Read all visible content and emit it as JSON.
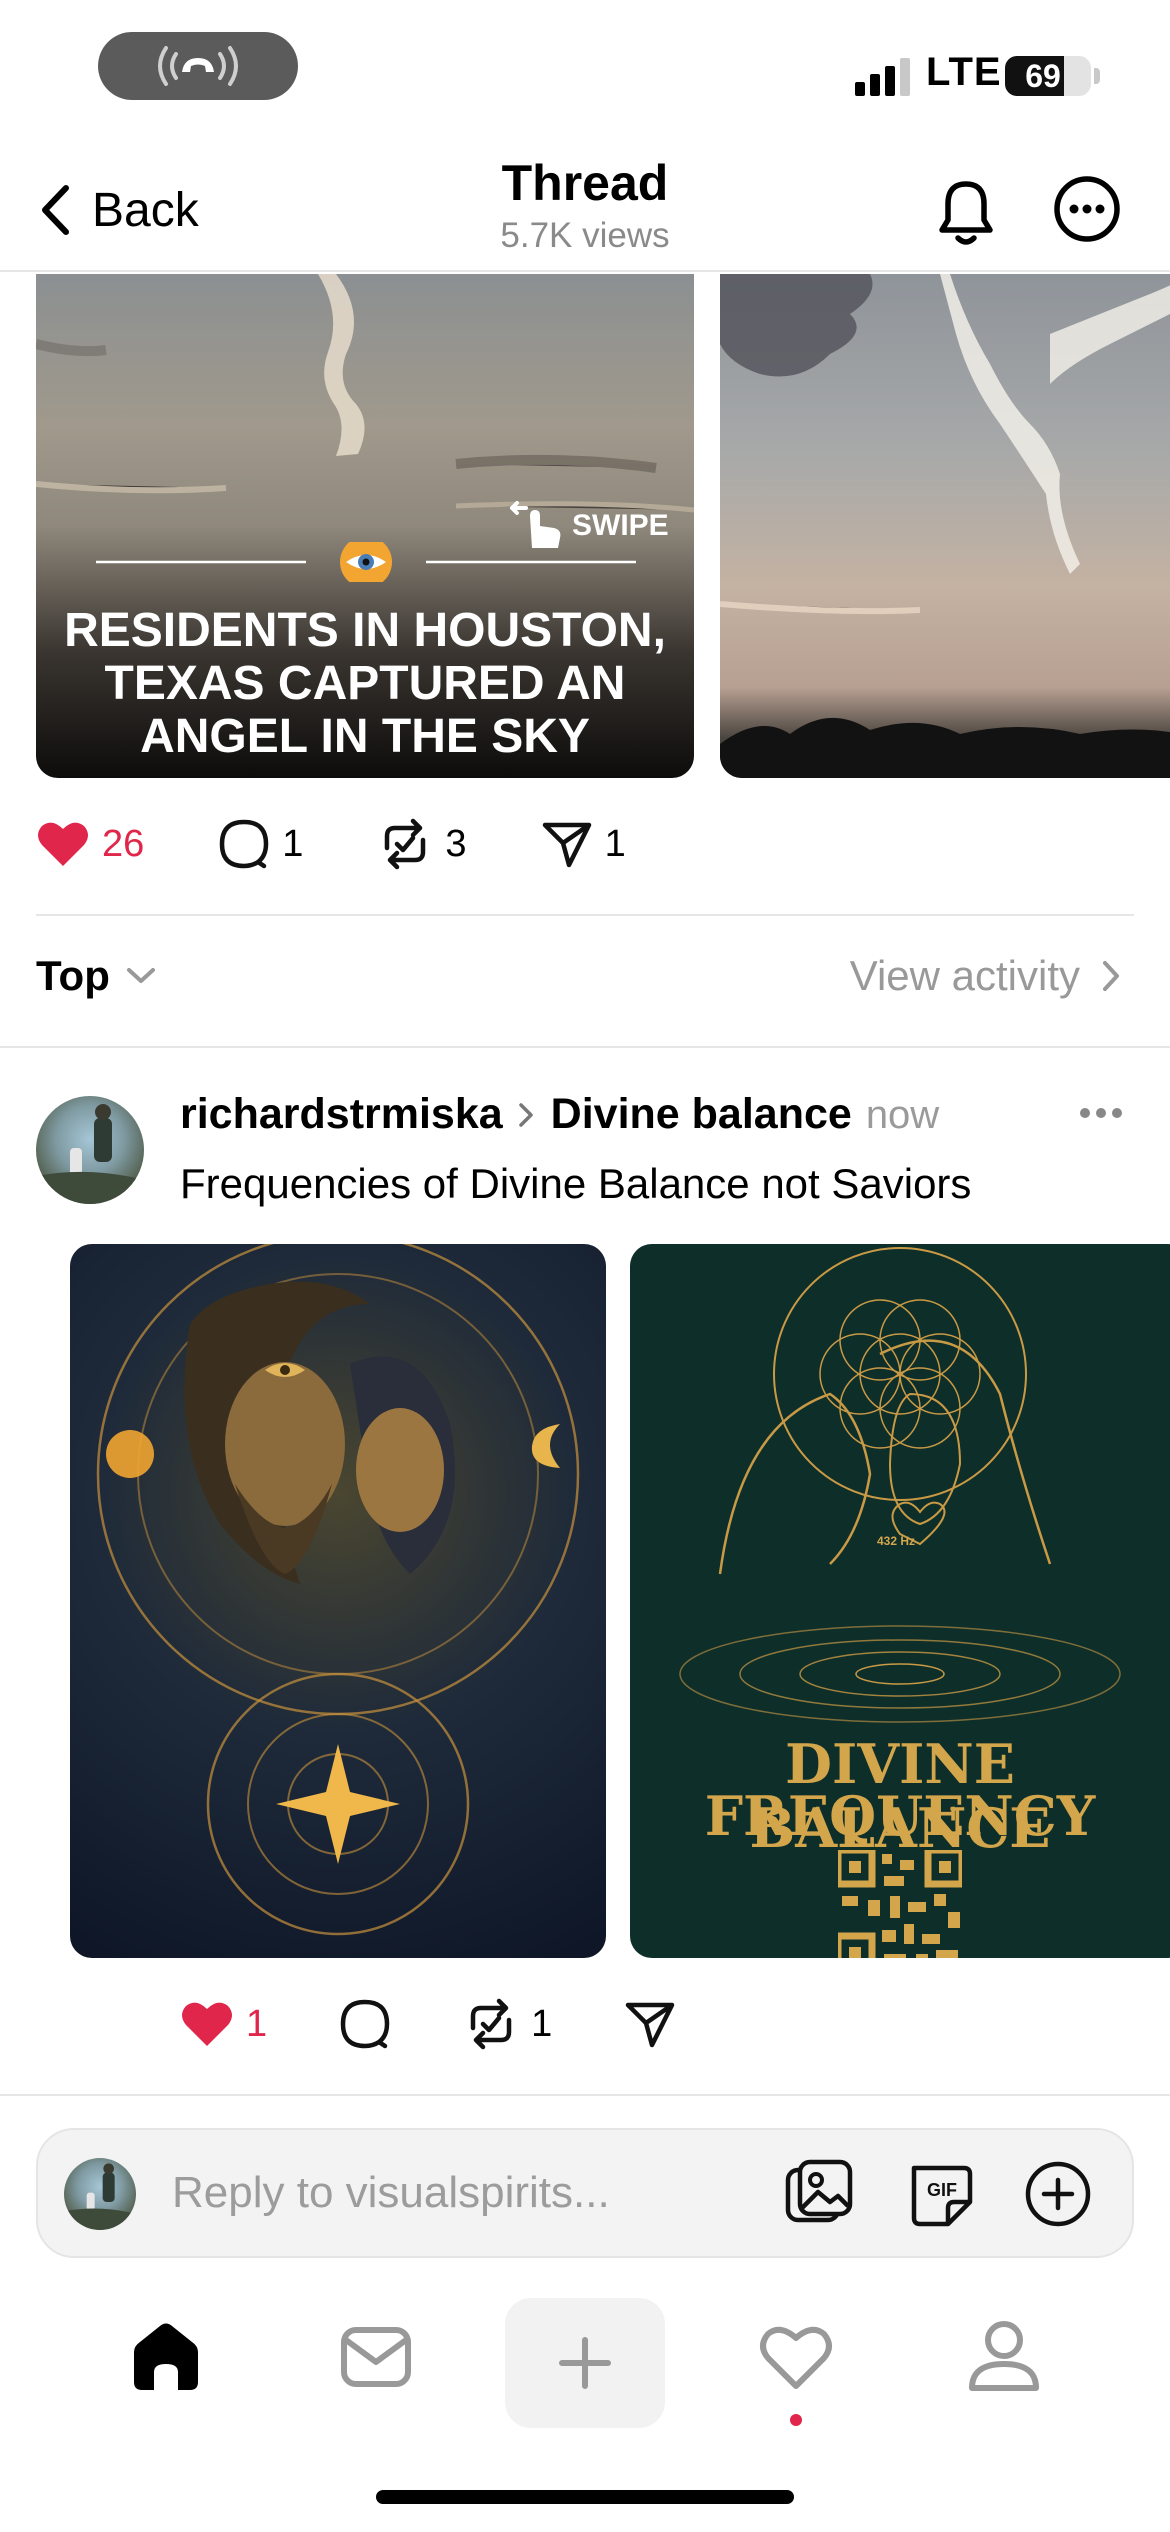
{
  "status_bar": {
    "network": "LTE",
    "battery": "69",
    "battery_level": 0.69,
    "signal_bars": 3
  },
  "header": {
    "back_label": "Back",
    "title": "Thread",
    "subtitle": "5.7K views"
  },
  "main_post": {
    "media_1": {
      "swipe_label": "SWIPE",
      "headline": "RESIDENTS IN HOUSTON, TEXAS CAPTURED AN ANGEL IN THE SKY"
    },
    "actions": {
      "likes": "26",
      "comments": "1",
      "reposts": "3",
      "shares": "1"
    }
  },
  "sort_bar": {
    "sort_label": "Top",
    "activity_label": "View activity"
  },
  "reply": {
    "username": "richardstrmiska",
    "topic": "Divine balance",
    "time": "now",
    "text": "Frequencies of Divine Balance not Saviors",
    "image_b": {
      "line1": "DIVINE BALANCE",
      "line2": "FREQUENCY",
      "hz_label": "432 Hz"
    },
    "actions": {
      "likes": "1",
      "reposts": "1"
    }
  },
  "composer": {
    "placeholder": "Reply to visualspirits...",
    "gif_label": "GIF"
  },
  "colors": {
    "like_red": "#e0264a",
    "muted_gray": "#999999",
    "gold": "#d4a64c"
  },
  "icons": [
    "phone-call-icon",
    "signal-icon",
    "back-chevron-icon",
    "bell-icon",
    "more-icon",
    "swipe-hand-icon",
    "eye-emoji-icon",
    "heart-icon",
    "comment-icon",
    "repost-icon",
    "share-icon",
    "chevron-down-icon",
    "chevron-right-icon",
    "photo-icon",
    "gif-icon",
    "plus-circle-icon",
    "home-icon",
    "inbox-icon",
    "plus-icon",
    "activity-heart-icon",
    "profile-icon"
  ]
}
